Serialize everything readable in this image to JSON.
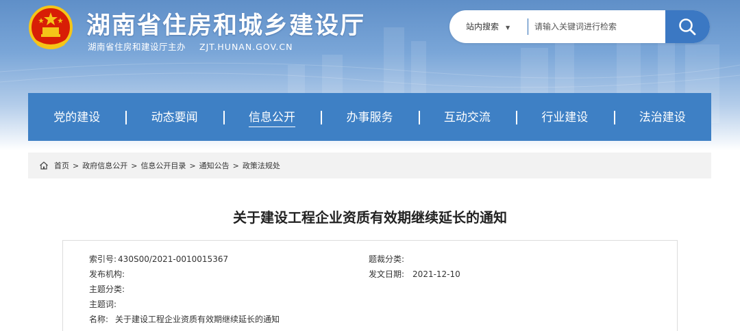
{
  "header": {
    "title": "湖南省住房和城乡建设厅",
    "sponsor": "湖南省住房和建设厅主办",
    "domain": "ZJT.HUNAN.GOV.CN"
  },
  "search": {
    "scope": "站内搜索",
    "placeholder": "请输入关键词进行检索",
    "value": ""
  },
  "nav": {
    "items": [
      {
        "label": "党的建设"
      },
      {
        "label": "动态要闻"
      },
      {
        "label": "信息公开",
        "active": true
      },
      {
        "label": "办事服务"
      },
      {
        "label": "互动交流"
      },
      {
        "label": "行业建设"
      },
      {
        "label": "法治建设"
      }
    ]
  },
  "breadcrumb": {
    "items": [
      "首页",
      "政府信息公开",
      "信息公开目录",
      "通知公告",
      "政策法规处"
    ],
    "separator": ">"
  },
  "article": {
    "title": "关于建设工程企业资质有效期继续延长的通知",
    "meta": {
      "index_label": "索引号:",
      "index_value": "430S00/2021-0010015367",
      "category_label": "题裁分类:",
      "category_value": "",
      "publisher_label": "发布机构:",
      "publisher_value": "",
      "date_label": "发文日期:",
      "date_value": "2021-12-10",
      "topic_label": "主题分类:",
      "topic_value": "",
      "keywords_label": "主题词:",
      "keywords_value": "",
      "name_label": "名称:",
      "name_value": "关于建设工程企业资质有效期继续延长的通知"
    }
  },
  "colors": {
    "nav_bg": "#3e80c5",
    "search_button": "#3b78c3",
    "header_top": "#5f8fc8",
    "breadcrumb_bg": "#f2f2f2"
  },
  "icons": {
    "emblem": "national-emblem-icon",
    "search": "magnifier-icon",
    "home": "home-icon"
  }
}
